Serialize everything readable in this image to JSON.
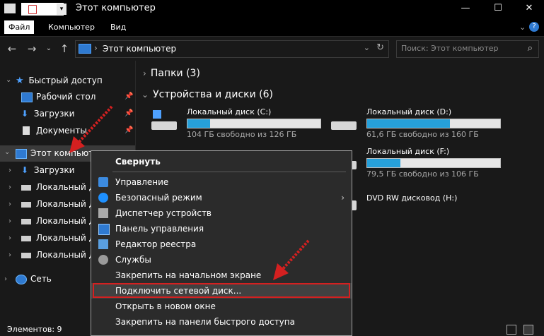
{
  "window": {
    "title": "Этот компьютер",
    "controls": {
      "minimize": "—",
      "maximize": "☐",
      "close": "✕"
    }
  },
  "ribbon": {
    "tabs": [
      "Файл",
      "Компьютер",
      "Вид"
    ],
    "expand": "⌄",
    "help": "?"
  },
  "nav": {
    "back": "←",
    "forward": "→",
    "dropdown": "⌄",
    "up": "↑",
    "address": "Этот компьютер",
    "address_sep": "›",
    "addr_dropdown": "⌄",
    "refresh": "↻",
    "search_placeholder": "Поиск: Этот компьютер",
    "search_icon": "⌕"
  },
  "sidebar": {
    "quick_access": "Быстрый доступ",
    "quick_items": [
      "Рабочий стол",
      "Загрузки",
      "Документы"
    ],
    "this_pc": "Этот компьютер",
    "pc_items": [
      "Загрузки",
      "Локальный диск",
      "Локальный диск",
      "Локальный диск",
      "Локальный диск",
      "Локальный диск"
    ],
    "network": "Сеть"
  },
  "main": {
    "folders_group": "Папки (3)",
    "devices_group": "Устройства и диски (6)",
    "drives": [
      {
        "name": "Локальный диск (C:)",
        "free": "104 ГБ свободно из 126 ГБ",
        "used_fraction": 0.17
      },
      {
        "name": "Локальный диск (D:)",
        "free": "61,6 ГБ свободно из 160 ГБ",
        "used_fraction": 0.62
      },
      {
        "name": "Локальный диск (F:)",
        "free": "79,5 ГБ свободно из 106 ГБ",
        "used_fraction": 0.25
      },
      {
        "name": "DVD RW дисковод (H:)"
      }
    ]
  },
  "context_menu": {
    "items": [
      "Свернуть",
      "Управление",
      "Безопасный режим",
      "Диспетчер устройств",
      "Панель управления",
      "Редактор реестра",
      "Службы",
      "Закрепить на начальном экране",
      "Подключить сетевой диск...",
      "Открыть в новом окне",
      "Закрепить на панели быстрого доступа"
    ],
    "submenu_arrow": "›"
  },
  "status": {
    "items": "Элементов: 9"
  },
  "colors": {
    "accent": "#26a0da",
    "highlight_border": "#d42020",
    "arrow": "#d42020"
  }
}
